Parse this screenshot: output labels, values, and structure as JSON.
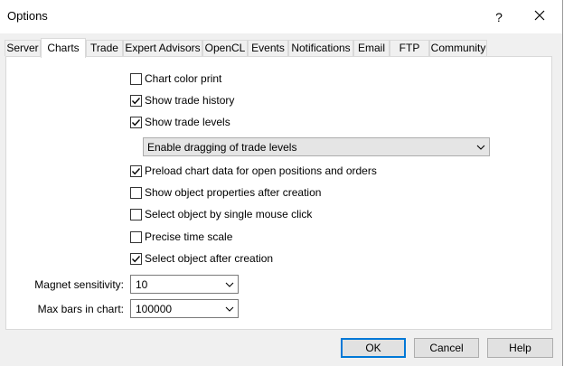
{
  "window": {
    "title": "Options",
    "help_label": "?"
  },
  "tabs": [
    {
      "label": "Server",
      "active": false
    },
    {
      "label": "Charts",
      "active": true
    },
    {
      "label": "Trade",
      "active": false
    },
    {
      "label": "Expert Advisors",
      "active": false
    },
    {
      "label": "OpenCL",
      "active": false
    },
    {
      "label": "Events",
      "active": false
    },
    {
      "label": "Notifications",
      "active": false
    },
    {
      "label": "Email",
      "active": false
    },
    {
      "label": "FTP",
      "active": false
    },
    {
      "label": "Community",
      "active": false
    }
  ],
  "charts": {
    "chart_color_print": {
      "label": "Chart color print",
      "checked": false
    },
    "show_trade_history": {
      "label": "Show trade history",
      "checked": true
    },
    "show_trade_levels": {
      "label": "Show trade levels",
      "checked": true
    },
    "trade_levels_mode": {
      "value": "Enable dragging of trade levels"
    },
    "preload_chart_data": {
      "label": "Preload chart data for open positions and orders",
      "checked": true
    },
    "show_object_properties": {
      "label": "Show object properties after creation",
      "checked": false
    },
    "select_by_single_click": {
      "label": "Select object by single mouse click",
      "checked": false
    },
    "precise_time_scale": {
      "label": "Precise time scale",
      "checked": false
    },
    "select_after_creation": {
      "label": "Select object after creation",
      "checked": true
    },
    "magnet_sensitivity": {
      "label": "Magnet sensitivity:",
      "value": "10"
    },
    "max_bars": {
      "label": "Max bars in chart:",
      "value": "100000"
    }
  },
  "buttons": {
    "ok": "OK",
    "cancel": "Cancel",
    "help": "Help"
  },
  "colors": {
    "accent": "#0078d7",
    "panel_bg": "#ffffff",
    "dialog_bg": "#f0f0f0"
  },
  "icons": {
    "close": "close-icon",
    "dropdown": "chevron-down-icon",
    "check": "checkmark-icon"
  }
}
